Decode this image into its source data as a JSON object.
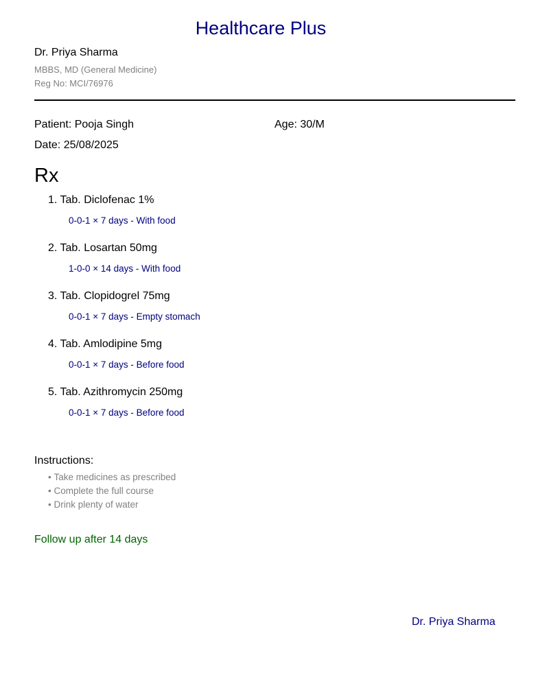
{
  "header": {
    "clinic_name": "Healthcare Plus",
    "doctor_name": "Dr. Priya Sharma",
    "qualification": "MBBS, MD (General Medicine)",
    "registration": "Reg No: MCI/76976"
  },
  "patient": {
    "name_line": "Patient: Pooja Singh",
    "age_line": "Age: 30/M",
    "date_line": "Date: 25/08/2025"
  },
  "rx_symbol": "Rx",
  "medications": [
    {
      "name": "1. Tab. Diclofenac 1%",
      "dosage": "0-0-1 × 7 days - With food"
    },
    {
      "name": "2. Tab. Losartan 50mg",
      "dosage": "1-0-0 × 14 days - With food"
    },
    {
      "name": "3. Tab. Clopidogrel 75mg",
      "dosage": "0-0-1 × 7 days - Empty stomach"
    },
    {
      "name": "4. Tab. Amlodipine 5mg",
      "dosage": "0-0-1 × 7 days - Before food"
    },
    {
      "name": "5. Tab. Azithromycin 250mg",
      "dosage": "0-0-1 × 7 days - Before food"
    }
  ],
  "instructions": {
    "heading": "Instructions:",
    "items": [
      "Take medicines as prescribed",
      "Complete the full course",
      "Drink plenty of water"
    ]
  },
  "follow_up": "Follow up after 14 days",
  "signature": "Dr. Priya Sharma",
  "colors": {
    "clinic_title": "#000080",
    "dosage_text": "#000080",
    "muted_text": "#808080",
    "follow_up": "#006400",
    "signature": "#000080"
  }
}
